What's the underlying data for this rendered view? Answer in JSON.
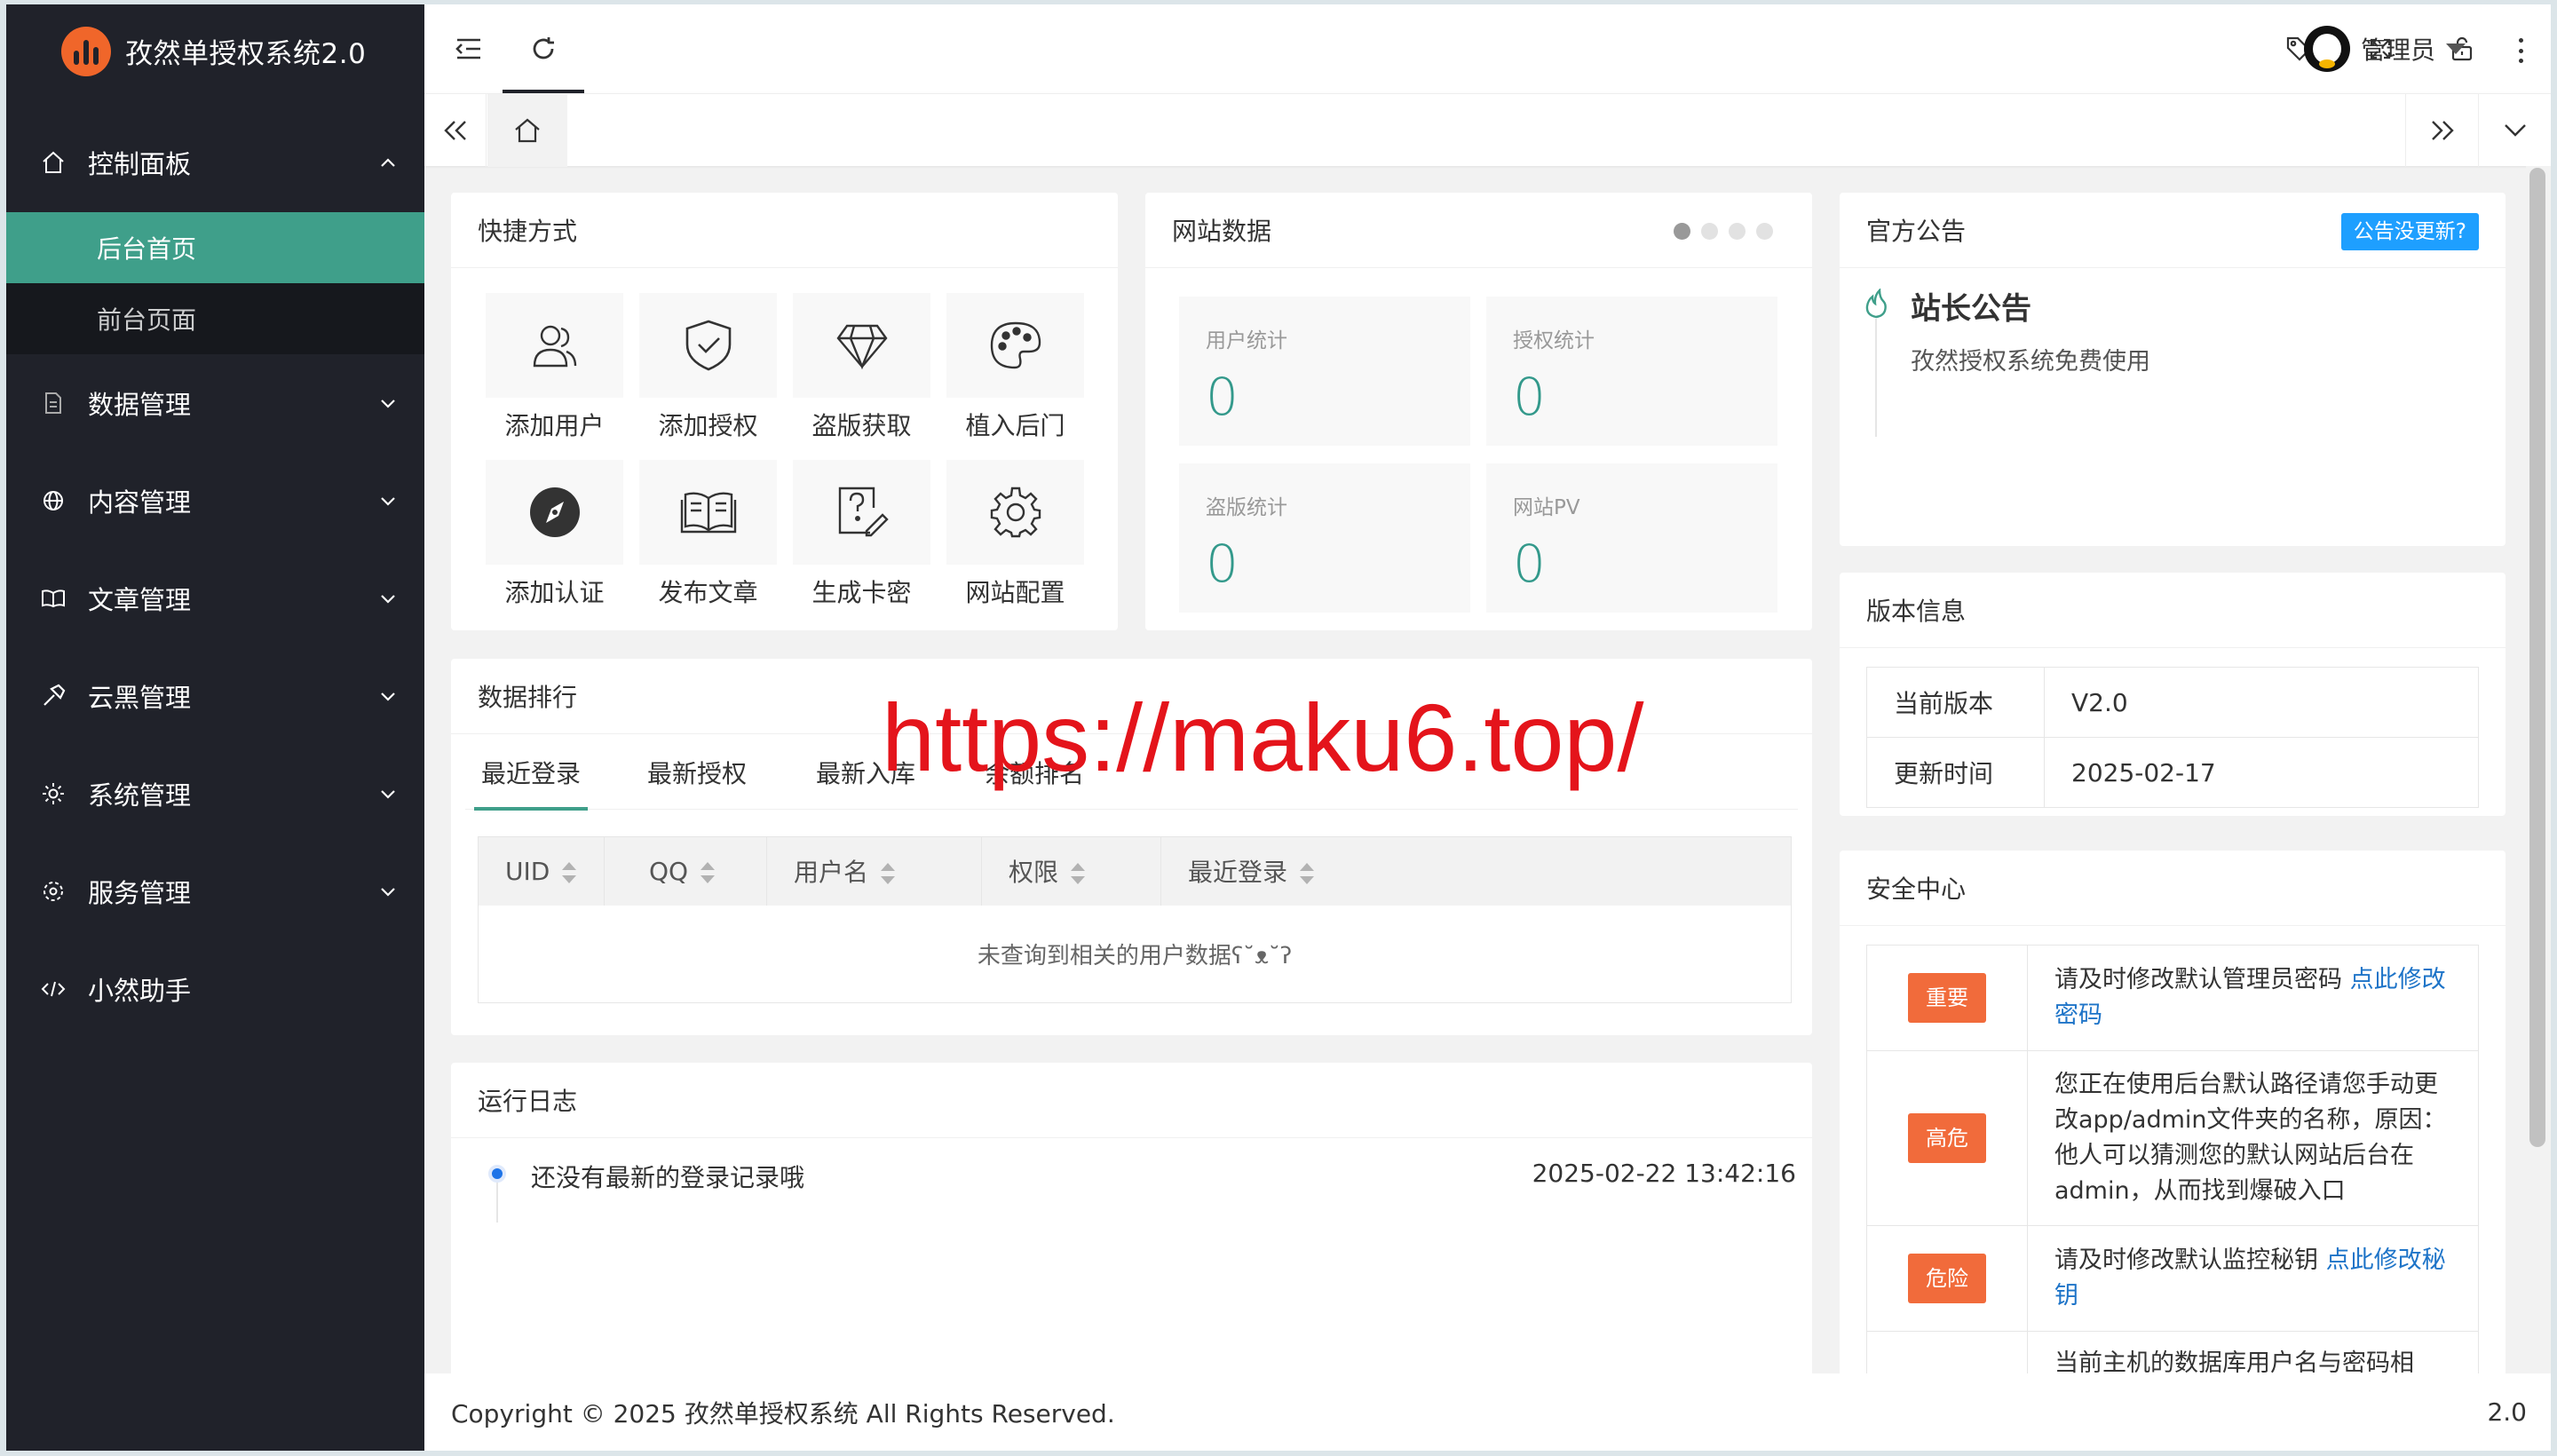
{
  "app": {
    "title": "孜然单授权系统2.0"
  },
  "sidebar": {
    "items": [
      {
        "label": "控制面板",
        "icon": "home-icon",
        "expanded": true,
        "children": [
          {
            "label": "后台首页",
            "active": true
          },
          {
            "label": "前台页面",
            "active": false
          }
        ]
      },
      {
        "label": "数据管理",
        "icon": "document-icon"
      },
      {
        "label": "内容管理",
        "icon": "globe-icon"
      },
      {
        "label": "文章管理",
        "icon": "book-icon"
      },
      {
        "label": "云黑管理",
        "icon": "hammer-icon"
      },
      {
        "label": "系统管理",
        "icon": "gear-icon"
      },
      {
        "label": "服务管理",
        "icon": "service-icon"
      },
      {
        "label": "小然助手",
        "icon": "code-icon"
      }
    ]
  },
  "header": {
    "user_name": "管理员"
  },
  "shortcuts": {
    "title": "快捷方式",
    "items": [
      {
        "label": "添加用户",
        "icon": "users-icon"
      },
      {
        "label": "添加授权",
        "icon": "shield-check-icon"
      },
      {
        "label": "盗版获取",
        "icon": "diamond-icon"
      },
      {
        "label": "植入后门",
        "icon": "palette-icon"
      },
      {
        "label": "添加认证",
        "icon": "compass-icon"
      },
      {
        "label": "发布文章",
        "icon": "open-book-icon"
      },
      {
        "label": "生成卡密",
        "icon": "question-edit-icon"
      },
      {
        "label": "网站配置",
        "icon": "gear-icon"
      }
    ]
  },
  "site_data": {
    "title": "网站数据",
    "carousel_active_index": 0,
    "stats": [
      {
        "label": "用户统计",
        "value": "0"
      },
      {
        "label": "授权统计",
        "value": "0"
      },
      {
        "label": "盗版统计",
        "value": "0"
      },
      {
        "label": "网站PV",
        "value": "0"
      }
    ]
  },
  "notice": {
    "title": "官方公告",
    "button": "公告没更新?",
    "heading": "站长公告",
    "text": "孜然授权系统免费使用"
  },
  "ranking": {
    "title": "数据排行",
    "tabs": [
      "最近登录",
      "最新授权",
      "最新入库",
      "余额排名"
    ],
    "active_tab": 0,
    "columns": [
      "UID",
      "QQ",
      "用户名",
      "权限",
      "最近登录"
    ],
    "empty_text": "未查询到相关的用户数据ʕ˘ᴥ˘ʔ"
  },
  "version": {
    "title": "版本信息",
    "rows": [
      {
        "label": "当前版本",
        "value": "V2.0"
      },
      {
        "label": "更新时间",
        "value": "2025-02-17"
      }
    ]
  },
  "security": {
    "title": "安全中心",
    "rows": [
      {
        "level": "重要",
        "text": "请及时修改默认管理员密码 ",
        "link": "点此修改密码"
      },
      {
        "level": "高危",
        "text": "您正在使用后台默认路径请您手动更改app/admin文件夹的名称，原因：他人可以猜测您的默认网站后台在admin，从而找到爆破入口",
        "link": ""
      },
      {
        "level": "危险",
        "text": "请及时修改默认监控秘钥 ",
        "link": "点此修改秘钥"
      },
      {
        "level": "",
        "text": "当前主机的数据库用户名与密码相",
        "link": ""
      }
    ]
  },
  "log": {
    "title": "运行日志",
    "entries": [
      {
        "text": "还没有最新的登录记录哦",
        "time": "2025-02-22 13:42:16"
      }
    ]
  },
  "footer": {
    "copyright": "Copyright © 2025 孜然单授权系统 All Rights Reserved.",
    "version": "2.0"
  },
  "watermark": "https://maku6.top/",
  "colors": {
    "sidebar_bg": "#20222a",
    "accent": "#3f9f8a",
    "badge": "#f16b3b",
    "link": "#1e74c8",
    "notice_btn": "#1e9fff",
    "watermark": "#e4141b"
  }
}
